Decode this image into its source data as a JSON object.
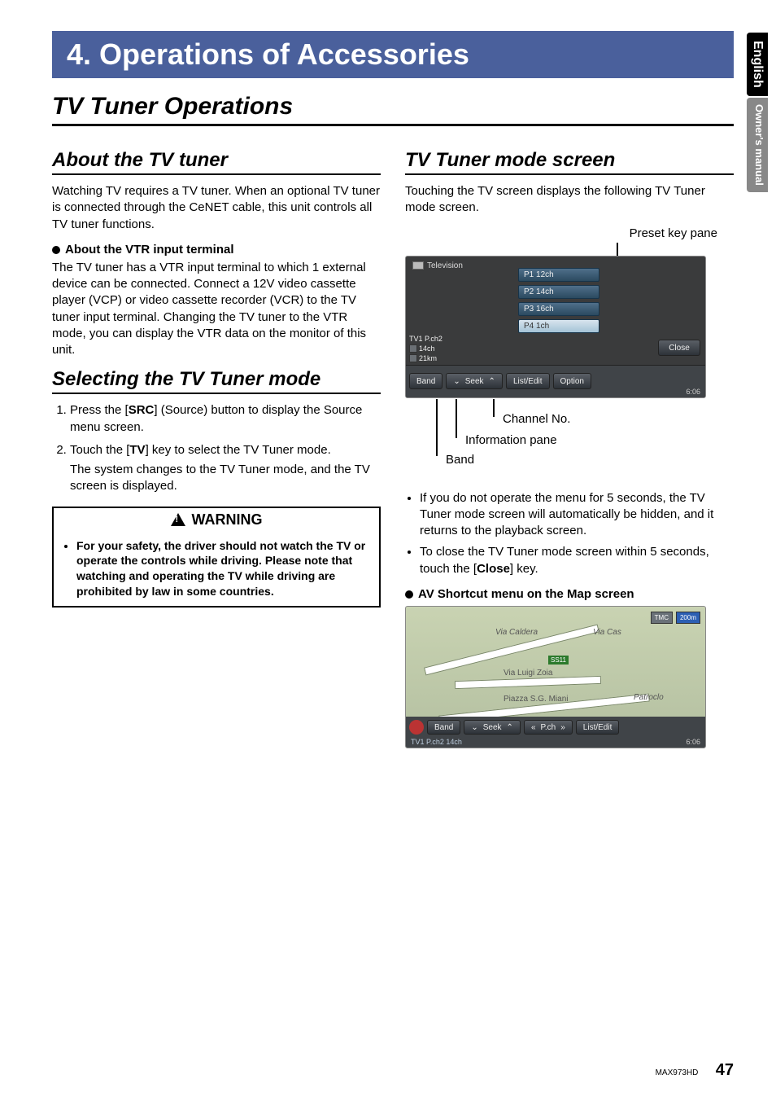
{
  "side_tabs": {
    "lang": "English",
    "section": "Owner's manual"
  },
  "chapter": "4.   Operations of Accessories",
  "main_title": "TV Tuner Operations",
  "left": {
    "about_title": "About the TV tuner",
    "about_para": "Watching TV requires a TV tuner. When an optional TV tuner is connected through the CeNET cable, this unit controls all TV tuner functions.",
    "vtr_head": "About the VTR input terminal",
    "vtr_para": "The TV tuner has a VTR input terminal to which 1 external device can be connected. Connect a 12V video cassette player (VCP) or video cassette recorder (VCR) to the TV tuner input terminal. Changing the TV tuner to the VTR mode, you can display the VTR data on the monitor of this unit.",
    "select_title": "Selecting the TV Tuner mode",
    "steps": {
      "s1a": "Press the [",
      "s1b": "SRC",
      "s1c": "] (Source) button to display the Source menu screen.",
      "s2a": "Touch the [",
      "s2b": "TV",
      "s2c": "] key to select the TV Tuner mode.",
      "s2d": "The system changes to the TV Tuner mode, and the TV screen is displayed."
    },
    "warning_label": "WARNING",
    "warning_text": "For your safety, the driver should not watch the TV or operate the controls while driving. Please note that watching and operating the TV while driving are prohibited by law in some countries."
  },
  "right": {
    "mode_title": "TV Tuner mode screen",
    "mode_para": "Touching the TV screen displays the following TV Tuner mode screen.",
    "annot": {
      "preset": "Preset key pane",
      "channel": "Channel No.",
      "info": "Information pane",
      "band": "Band"
    },
    "screen1": {
      "title": "Television",
      "presets": [
        "P1 12ch",
        "P2 14ch",
        "P3 16ch",
        "P4 1ch"
      ],
      "close": "Close",
      "bottom": {
        "band": "Band",
        "seek": "Seek",
        "list": "List/Edit",
        "option": "Option",
        "time": "6:06"
      },
      "info": {
        "line1": "TV1 P.ch2",
        "line2b": "14ch",
        "dist": "21km"
      }
    },
    "bullets": {
      "b1": "If you do not operate the menu for 5 seconds, the TV Tuner mode screen will automatically be hidden, and it returns to the playback screen.",
      "b2a": "To close the TV Tuner mode screen within 5 seconds, touch the [",
      "b2b": "Close",
      "b2c": "] key."
    },
    "shortcut_head": "AV Shortcut menu on the Map screen",
    "screen2": {
      "tmc": "TMC",
      "scale": "200m",
      "roads": {
        "r1": "Via Caldera",
        "r2": "Via Cas",
        "r3": "Via Luigi Zoia",
        "r4": "Piazza S.G. Miani",
        "r5": "Patroclo",
        "route": "SS11"
      },
      "bottom": {
        "band": "Band",
        "seek": "Seek",
        "pch": "P.ch",
        "list": "List/Edit"
      },
      "status": "TV1   P.ch2   14ch",
      "time": "6:06"
    }
  },
  "footer": {
    "model": "MAX973HD",
    "page": "47"
  }
}
